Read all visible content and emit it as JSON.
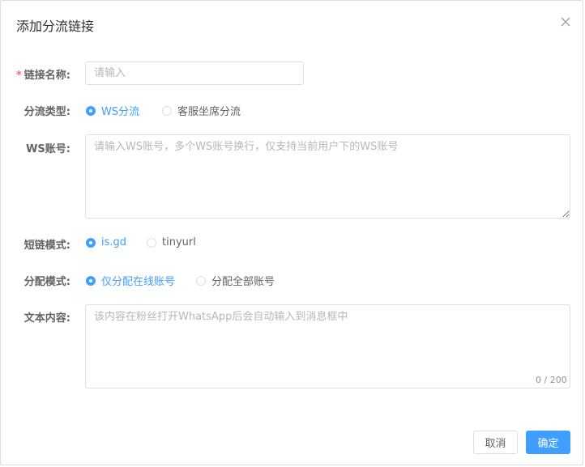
{
  "dialog": {
    "title": "添加分流链接",
    "close_icon": "close-icon"
  },
  "form": {
    "link_name": {
      "label": "链接名称:",
      "required_mark": "*",
      "placeholder": "请输入",
      "value": ""
    },
    "split_type": {
      "label": "分流类型:",
      "options": [
        {
          "label": "WS分流",
          "selected": true
        },
        {
          "label": "客服坐席分流",
          "selected": false
        }
      ]
    },
    "ws_account": {
      "label": "WS账号:",
      "placeholder": "请输入WS账号，多个WS账号换行，仅支持当前用户下的WS账号",
      "value": ""
    },
    "short_link_mode": {
      "label": "短链模式:",
      "options": [
        {
          "label": "is.gd",
          "selected": true
        },
        {
          "label": "tinyurl",
          "selected": false
        }
      ]
    },
    "assign_mode": {
      "label": "分配模式:",
      "options": [
        {
          "label": "仅分配在线账号",
          "selected": true
        },
        {
          "label": "分配全部账号",
          "selected": false
        }
      ]
    },
    "text_content": {
      "label": "文本内容:",
      "placeholder": "该内容在粉丝打开WhatsApp后会自动输入到消息框中",
      "value": "",
      "counter": "0 / 200"
    }
  },
  "footer": {
    "cancel_label": "取消",
    "confirm_label": "确定"
  },
  "colors": {
    "primary": "#409eff",
    "required": "#f56c6c",
    "border": "#dcdfe6"
  }
}
